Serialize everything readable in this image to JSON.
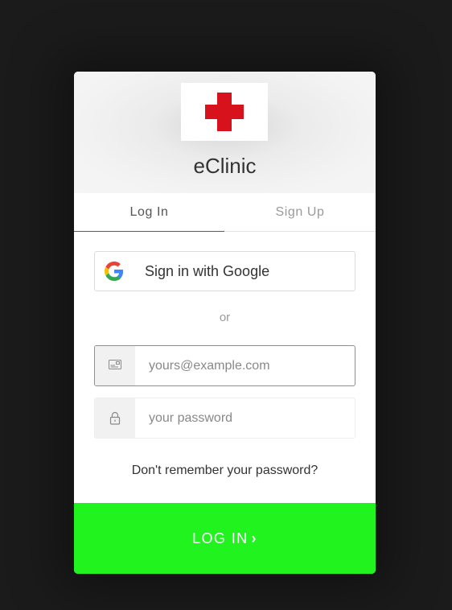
{
  "app": {
    "title": "eClinic",
    "logo": "red-cross-logo",
    "colors": {
      "background": "#1b1b1b",
      "logo_cross": "#d7121c",
      "submit_button": "#21f31f"
    }
  },
  "tabs": [
    {
      "label": "Log In",
      "active": true
    },
    {
      "label": "Sign Up",
      "active": false
    }
  ],
  "social": {
    "google_label": "Sign in with Google",
    "icon": "google-icon"
  },
  "separator": "or",
  "form": {
    "email": {
      "placeholder": "yours@example.com",
      "value": "",
      "icon": "email-card-icon"
    },
    "password": {
      "placeholder": "your password",
      "value": "",
      "icon": "lock-icon"
    }
  },
  "forgot_password": "Don't remember your password?",
  "submit": {
    "label": "LOG IN",
    "chevron": "›"
  }
}
